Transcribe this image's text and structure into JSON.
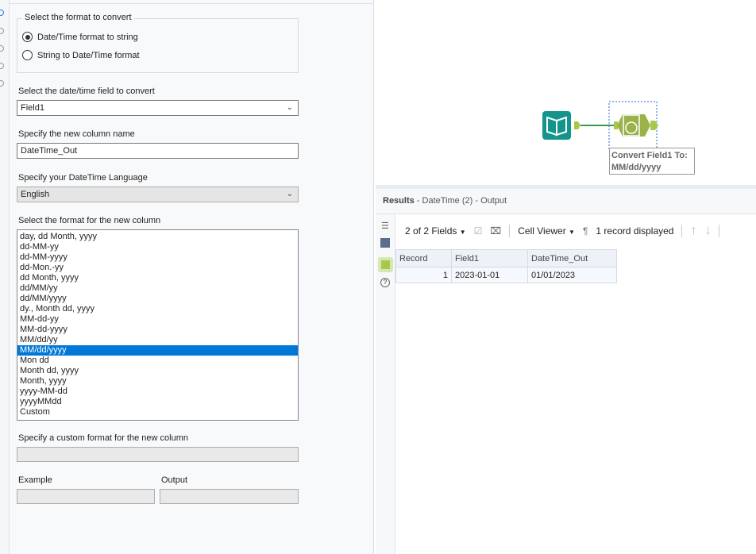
{
  "config": {
    "format_group_title": "Select the format to convert",
    "radio_options": [
      {
        "label": "Date/Time format to string",
        "selected": true
      },
      {
        "label": "String to Date/Time format",
        "selected": false
      }
    ],
    "field_label": "Select the date/time field to convert",
    "field_value": "Field1",
    "column_label": "Specify the new column name",
    "column_value": "DateTime_Out",
    "language_label": "Specify your DateTime Language",
    "language_value": "English",
    "format_list_label": "Select the format for the new column",
    "formats": [
      "day, dd Month, yyyy",
      "dd-MM-yy",
      "dd-MM-yyyy",
      "dd-Mon.-yy",
      "dd Month, yyyy",
      "dd/MM/yy",
      "dd/MM/yyyy",
      "dy., Month dd, yyyy",
      "MM-dd-yy",
      "MM-dd-yyyy",
      "MM/dd/yy",
      "MM/dd/yyyy",
      "Mon dd",
      "Month dd, yyyy",
      "Month, yyyy",
      "yyyy-MM-dd",
      "yyyyMMdd",
      "Custom"
    ],
    "selected_format": "MM/dd/yyyy",
    "custom_label": "Specify a custom format for the new column",
    "custom_value": "",
    "example_label": "Example",
    "output_label": "Output"
  },
  "canvas": {
    "annotation_line1": "Convert Field1 To:",
    "annotation_line2": "MM/dd/yyyy"
  },
  "results": {
    "title": "Results",
    "subtitle": " - DateTime (2) - Output",
    "fields": "2 of 2 Fields",
    "cell_viewer": "Cell Viewer",
    "record_count": "1 record displayed",
    "columns": [
      "Record",
      "Field1",
      "DateTime_Out"
    ],
    "rows": [
      [
        "1",
        "2023-01-01",
        "01/01/2023"
      ]
    ]
  }
}
